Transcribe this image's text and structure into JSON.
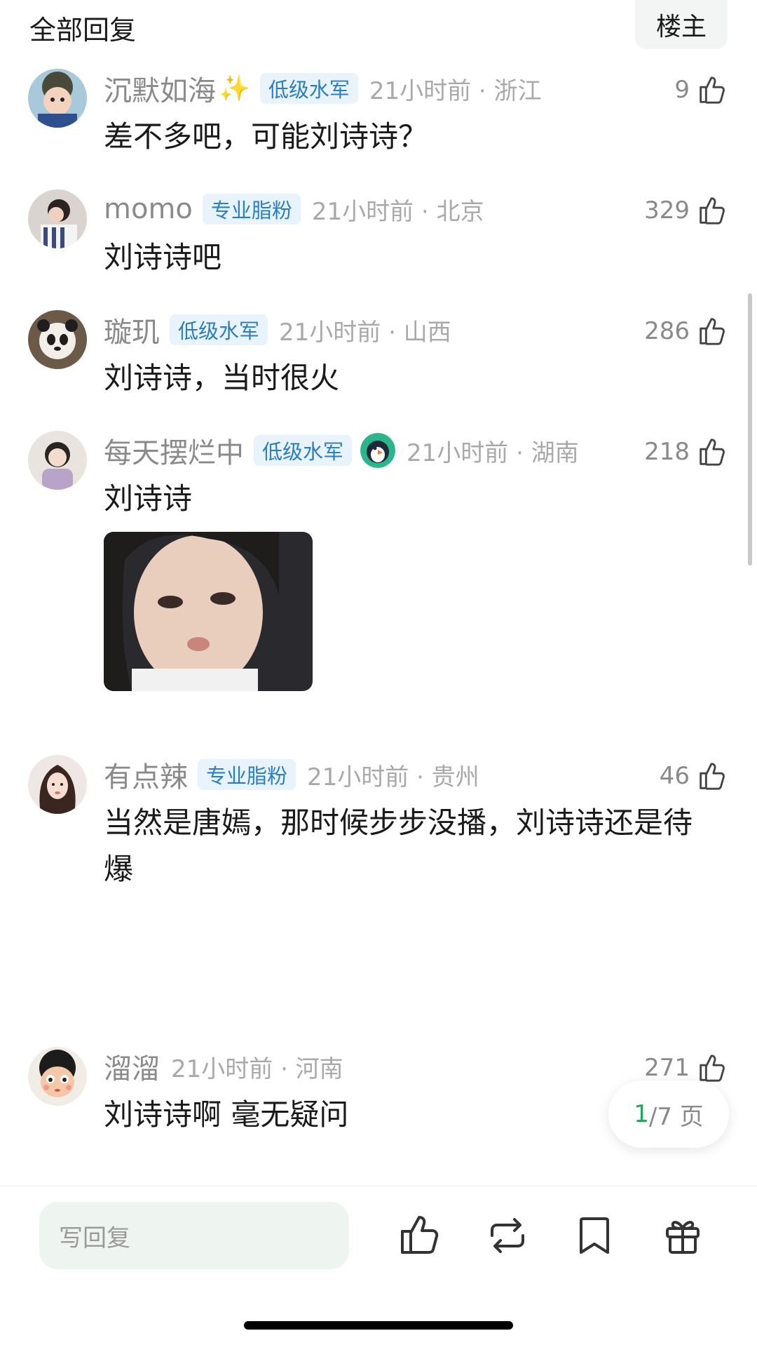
{
  "header": {
    "title": "全部回复",
    "op_label": "楼主"
  },
  "comments": [
    {
      "username": "沉默如海",
      "badge": "低级水军",
      "sparkle": "✨",
      "time": "21小时前 · 浙江",
      "likes": "9",
      "text": "差不多吧，可能刘诗诗？"
    },
    {
      "username": "momo",
      "badge": "专业脂粉",
      "time": "21小时前 · 北京",
      "likes": "329",
      "text": "刘诗诗吧"
    },
    {
      "username": "璇玑",
      "badge": "低级水军",
      "time": "21小时前 · 山西",
      "likes": "286",
      "text": "刘诗诗，当时很火"
    },
    {
      "username": "每天摆烂中",
      "badge": "低级水军",
      "time": "21小时前 · 湖南",
      "likes": "218",
      "text": "刘诗诗"
    },
    {
      "username": "有点辣",
      "badge": "专业脂粉",
      "time": "21小时前 · 贵州",
      "likes": "46",
      "text": "当然是唐嫣，那时候步步没播，刘诗诗还是待爆"
    },
    {
      "username": "溜溜",
      "time": "21小时前 · 河南",
      "likes": "271",
      "text": "刘诗诗啊  毫无疑问"
    }
  ],
  "pagination": {
    "current": "1",
    "total_text": "/7 页"
  },
  "bottom_bar": {
    "reply_placeholder": "写回复"
  },
  "icons": {
    "like": "thumbs-up-icon",
    "repost": "repost-icon",
    "bookmark": "bookmark-icon",
    "gift": "gift-icon",
    "fan": "puffin-fan-icon"
  },
  "colors": {
    "badge_bg": "#e8f3fb",
    "badge_text": "#2b7ec2",
    "page_current": "#21a45c",
    "reply_bg": "#eef5f1"
  }
}
